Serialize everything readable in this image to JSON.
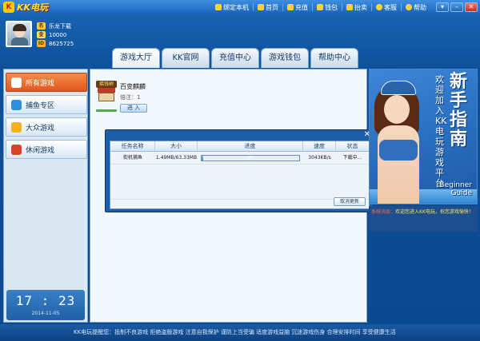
{
  "app": {
    "logo_mark": "K",
    "logo_text": "KK电玩"
  },
  "topnav": [
    {
      "label": "绑定本机",
      "icon": "lock-icon"
    },
    {
      "label": "首页",
      "icon": "home-icon"
    },
    {
      "label": "充值",
      "icon": "card-icon"
    },
    {
      "label": "钱包",
      "icon": "wallet-icon"
    },
    {
      "label": "抬卖",
      "icon": "bag-icon"
    },
    {
      "label": "客服",
      "icon": "user-icon"
    },
    {
      "label": "帮助",
      "icon": "help-icon"
    }
  ],
  "window_controls": {
    "menu": "▾",
    "minimize": "–",
    "close": "✕"
  },
  "user": {
    "name": "乐龙下载",
    "coins": "10000",
    "id": "8625725",
    "badges": [
      "名",
      "金",
      "ID"
    ]
  },
  "tabs": [
    "游戏大厅",
    "KK官网",
    "充值中心",
    "游戏钱包",
    "帮助中心"
  ],
  "sidebar": {
    "items": [
      {
        "label": "所有游戏",
        "color": "#ffffff"
      },
      {
        "label": "捕鱼专区",
        "color": "#2f8fdc"
      },
      {
        "label": "大众游戏",
        "color": "#f4b21d"
      },
      {
        "label": "休闲游戏",
        "color": "#d6452a"
      }
    ],
    "clock_time": "17 : 23",
    "clock_date": "2014-11-05"
  },
  "game": {
    "sign": "摇钱树",
    "name": "百变麒麟",
    "rate_label": "倍注：1",
    "enter_label": "进 入"
  },
  "download": {
    "close_label": "✕",
    "columns": [
      "任务名称",
      "大小",
      "进度",
      "速度",
      "状态"
    ],
    "rows": [
      {
        "name": "街机捕鱼",
        "size": "1.49MB/63.33MB",
        "progress_text": "2%",
        "progress": 0.02,
        "speed": "3043KB/s",
        "status": "下载中..."
      }
    ],
    "cancel_label": "取消更新"
  },
  "banner": {
    "title": "新手指南",
    "subtitle": "欢迎加入KK电玩游戏平台",
    "english": "Beginner\nGuide"
  },
  "notice": {
    "label": "系统消息：",
    "text": "欢迎您进入KK电玩，祝您游戏愉快！"
  },
  "ticker": "KK电玩提醒您：抵制不良游戏 拒绝盗版游戏 注意自我保护 谨防上当受骗 适度游戏益脑 沉迷游戏伤身 合理安排时间 享受健康生活"
}
